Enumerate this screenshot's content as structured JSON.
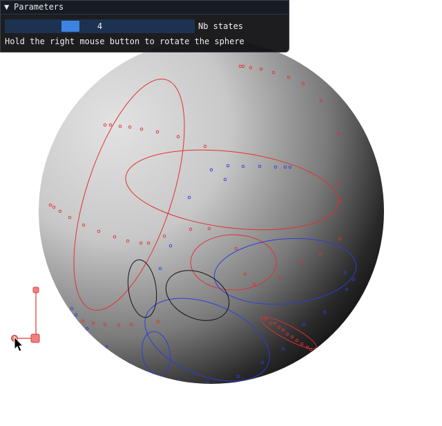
{
  "window": {
    "title": "Parameters",
    "collapse_icon": "triangle-down-icon"
  },
  "slider": {
    "value": "4",
    "label": "Nb states",
    "fraction": 0.33
  },
  "hint": "Hold the right mouse button to rotate the sphere",
  "colors": {
    "panel_bg": "#0f0f12",
    "slider_bg": "#1c3250",
    "slider_grab": "#3d84e0",
    "red": "#e03030",
    "blue": "#2a3fd8",
    "black": "#111111",
    "widget": "#e85a5a"
  },
  "icons": {
    "cursor": "mouse-pointer-icon",
    "gizmo": "rotation-gizmo-icon"
  }
}
